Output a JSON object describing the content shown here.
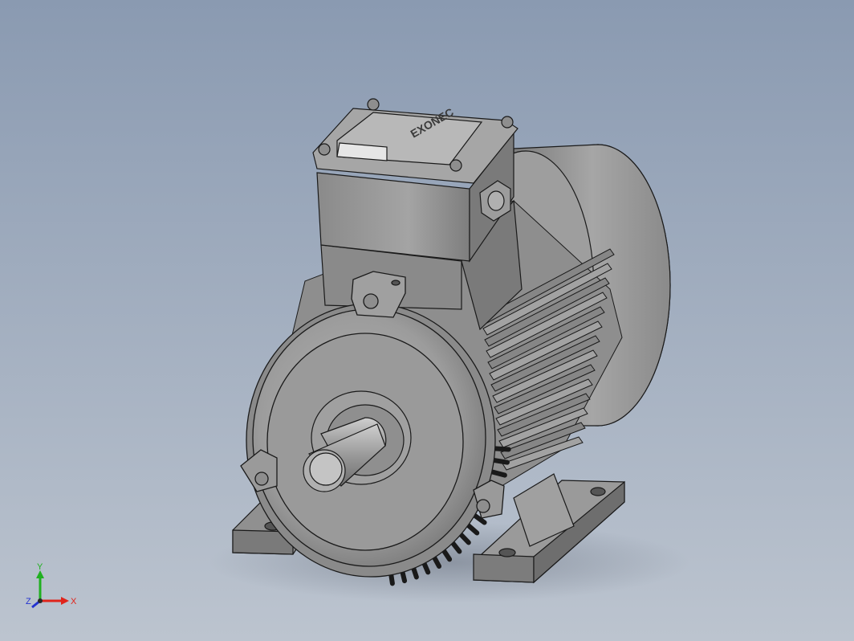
{
  "nameplate": {
    "text": "EXONEC"
  },
  "triad": {
    "x_label": "X",
    "y_label": "Y",
    "z_label": "Z",
    "x_color": "#e0241b",
    "y_color": "#20b020",
    "z_color": "#2433d0"
  },
  "model": {
    "name": "electric-motor",
    "body_color": "#9a9a9a",
    "edge_color": "#1a1a1a",
    "background_top": "#8a9ab1",
    "background_bottom": "#bcc4cf"
  }
}
